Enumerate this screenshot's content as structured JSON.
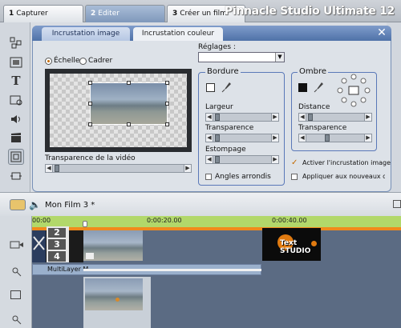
{
  "app": {
    "title": "Pinnacle Studio Ultimate 12"
  },
  "mode_tabs": [
    {
      "num": "1",
      "label": "Capturer"
    },
    {
      "num": "2",
      "label": "Editer"
    },
    {
      "num": "3",
      "label": "Créer un film"
    }
  ],
  "editor_tabs": {
    "image": "Incrustation image",
    "color": "Incrustation couleur"
  },
  "preview": {
    "scale_label": "Échelle",
    "crop_label": "Cadrer",
    "transparency_label": "Transparence de la vidéo",
    "transparency_value": 0
  },
  "settings": {
    "label": "Réglages :",
    "value": ""
  },
  "border": {
    "title": "Bordure",
    "width_label": "Largeur",
    "transparency_label": "Transparence",
    "blur_label": "Estompage",
    "rounded_label": "Angles arrondis",
    "width_value": 0,
    "transparency_value": 0,
    "blur_value": 0
  },
  "shadow": {
    "title": "Ombre",
    "distance_label": "Distance",
    "transparency_label": "Transparence",
    "distance_value": 0,
    "transparency_value": 0.32
  },
  "options": {
    "enable_label": "Activer l'incrustation image",
    "apply_new_label": "Appliquer aux nouveaux clips"
  },
  "timeline": {
    "film_title": "Mon Film 3 *",
    "ticks": [
      "00:00",
      "0:00:20.00",
      "0:00:40.00"
    ],
    "title_clip_label": "MultiLayer M",
    "clip_badge": "",
    "logo_text": "Text STUDIO",
    "title_numbers": [
      "2",
      "3",
      "4"
    ]
  },
  "colors": {
    "accent": "#4f72a8",
    "ruler_green": "#b2d86a",
    "ruler_orange": "#f08a1c",
    "track_bg": "#5b6b83"
  }
}
